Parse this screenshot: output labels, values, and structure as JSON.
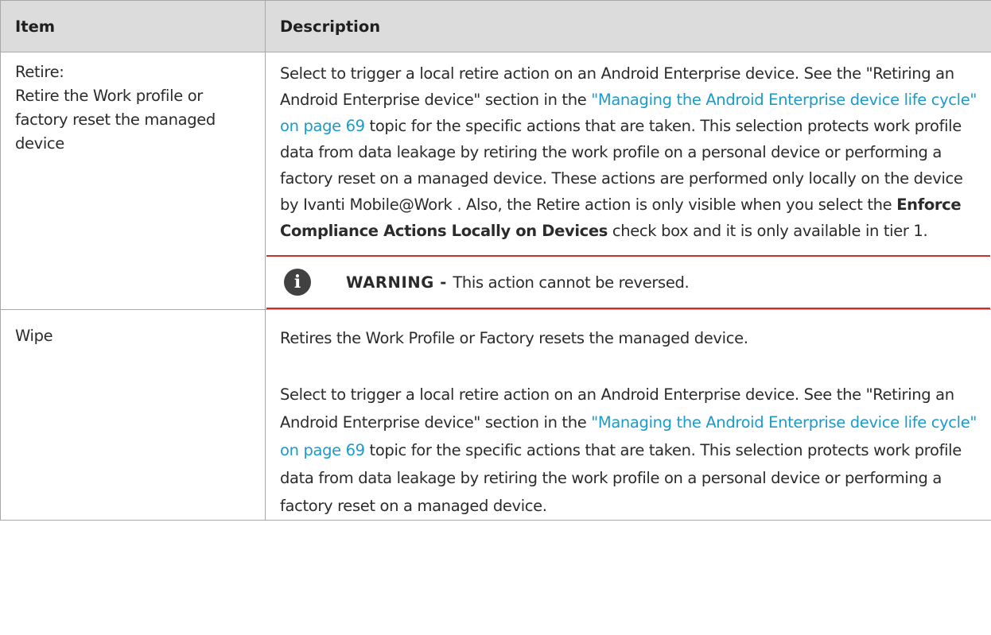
{
  "table": {
    "headers": {
      "item": "Item",
      "description": "Description"
    },
    "row_retire": {
      "item_line1": "Retire:",
      "item_line2": "Retire the Work profile or factory reset the managed device",
      "desc_a": "Select to trigger a local retire action on an Android Enterprise device. See the \"Retiring an Android Enterprise device\" section in the ",
      "desc_link": "\"Managing the Android Enterprise device life cycle\" on page 69",
      "desc_b": " topic for the specific actions that are taken. This selection protects work profile data from data leakage by retiring the work profile on a personal device or performing a factory reset on a managed device. These actions are performed only locally on the device by Ivanti Mobile@Work . Also, the Retire action is only visible when you select the ",
      "desc_bold": "Enforce Compliance Actions Locally on Devices",
      "desc_c": " check box and it is only available in tier 1.",
      "warning_icon": "info-icon",
      "warning_icon_glyph": "i",
      "warning_label": "WARNING - ",
      "warning_text": "This action cannot be reversed."
    },
    "row_wipe": {
      "item": "Wipe",
      "desc_intro": "Retires the Work Profile or Factory resets the managed device.",
      "desc_a": "Select to trigger a local retire action on an Android Enterprise device. See the \"Retiring an Android Enterprise device\" section in the ",
      "desc_link": "\"Managing the Android Enterprise device life cycle\" on page 69",
      "desc_b": " topic for the specific actions that are taken. This selection protects work profile data from data leakage by retiring the work profile on a personal device or performing a factory reset on a managed device."
    }
  },
  "colors": {
    "header_bg": "#dcdcdc",
    "link": "#1a9bc9",
    "warning_rule": "#c9312f",
    "icon_bg": "#414141"
  }
}
